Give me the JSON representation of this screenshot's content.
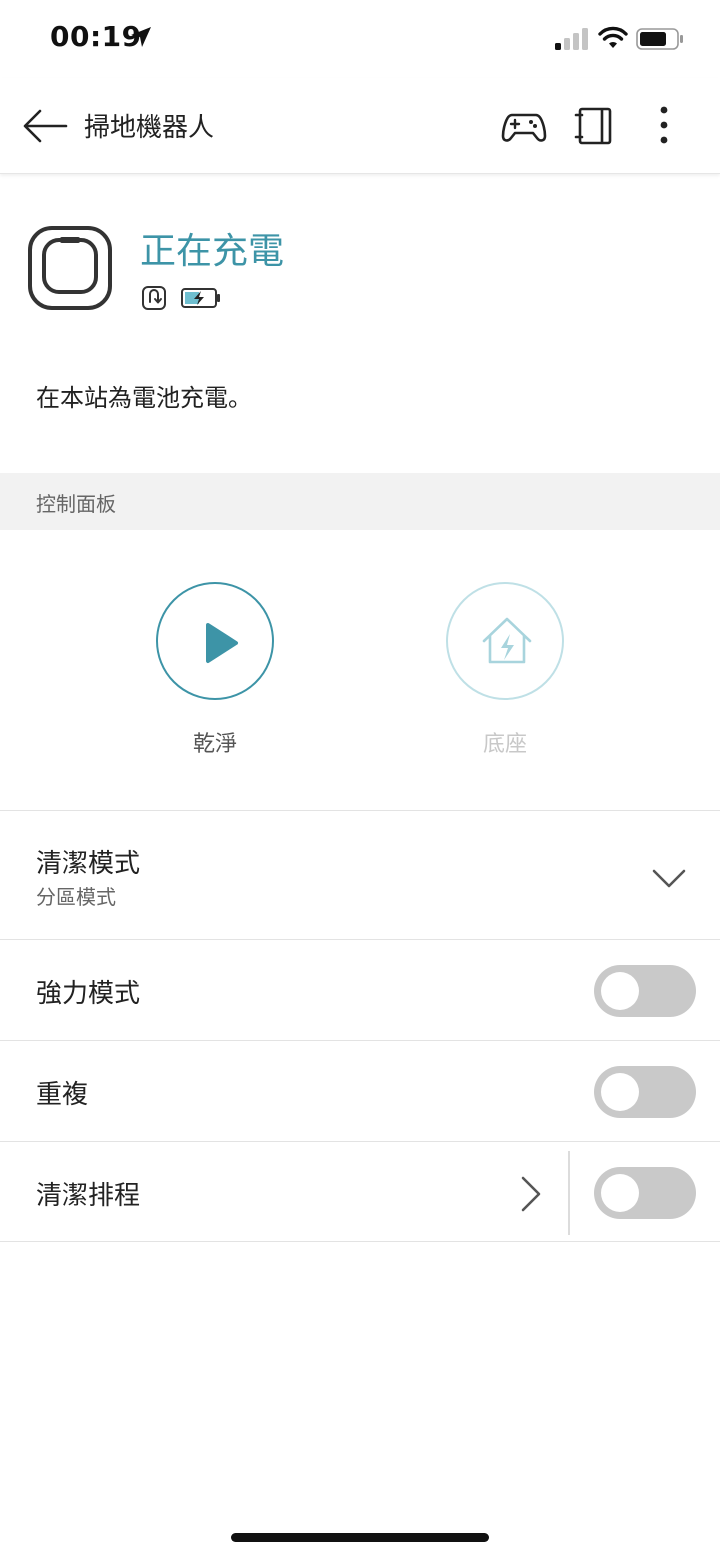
{
  "status_bar": {
    "time": "00:19"
  },
  "header": {
    "title": "掃地機器人"
  },
  "device": {
    "state_title": "正在充電",
    "state_description": "在本站為電池充電。"
  },
  "panel": {
    "section_title": "控制面板",
    "clean_label": "乾淨",
    "dock_label": "底座"
  },
  "settings": {
    "clean_mode_label": "清潔模式",
    "clean_mode_value": "分區模式",
    "power_mode_label": "強力模式",
    "power_mode_on": false,
    "repeat_label": "重複",
    "repeat_on": false,
    "schedule_label": "清潔排程",
    "schedule_on": false
  },
  "colors": {
    "accent": "#3d94a7",
    "accent_light": "#bfe0e6",
    "toggle_off": "#c9c9c9",
    "section_bg": "#f2f2f2"
  },
  "icons": [
    "location-arrow-icon",
    "signal-icon",
    "wifi-icon",
    "battery-icon",
    "back-arrow-icon",
    "gamepad-icon",
    "book-icon",
    "more-vertical-icon",
    "robot-device-icon",
    "return-dock-icon",
    "charging-battery-icon",
    "play-icon",
    "dock-home-icon",
    "chevron-down-icon",
    "chevron-right-icon"
  ]
}
